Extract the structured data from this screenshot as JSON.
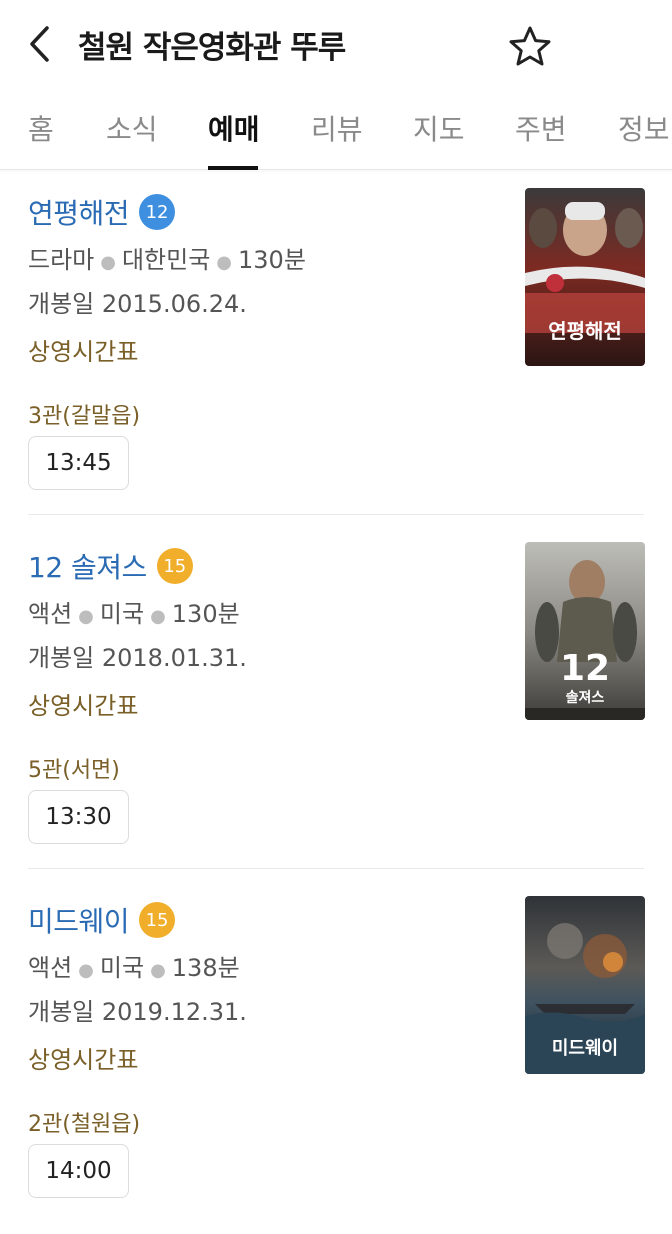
{
  "header": {
    "title": "철원 작은영화관 뚜루",
    "back_icon": "chevron-left-icon",
    "favorite_icon": "star-outline-icon"
  },
  "tabs": [
    {
      "label": "홈",
      "active": false
    },
    {
      "label": "소식",
      "active": false
    },
    {
      "label": "예매",
      "active": true
    },
    {
      "label": "리뷰",
      "active": false
    },
    {
      "label": "지도",
      "active": false
    },
    {
      "label": "주변",
      "active": false
    },
    {
      "label": "정보",
      "active": false
    }
  ],
  "colors": {
    "title_blue": "#2a6bb4",
    "link_brown": "#7a6028",
    "rating_12": "#3f8fe0",
    "rating_15": "#f1ae2b"
  },
  "movies": [
    {
      "title": "연평해전",
      "rating": "12",
      "genre": "드라마",
      "country": "대한민국",
      "runtime": "130분",
      "release": "개봉일 2015.06.24.",
      "schedule_label": "상영시간표",
      "hall": "3관(갈말읍)",
      "time": "13:45",
      "poster_text": "연평해전"
    },
    {
      "title": "12 솔져스",
      "rating": "15",
      "genre": "액션",
      "country": "미국",
      "runtime": "130분",
      "release": "개봉일 2018.01.31.",
      "schedule_label": "상영시간표",
      "hall": "5관(서면)",
      "time": "13:30",
      "poster_text": "12 솔져스"
    },
    {
      "title": "미드웨이",
      "rating": "15",
      "genre": "액션",
      "country": "미국",
      "runtime": "138분",
      "release": "개봉일 2019.12.31.",
      "schedule_label": "상영시간표",
      "hall": "2관(철원읍)",
      "time": "14:00",
      "poster_text": "미드웨이"
    }
  ]
}
